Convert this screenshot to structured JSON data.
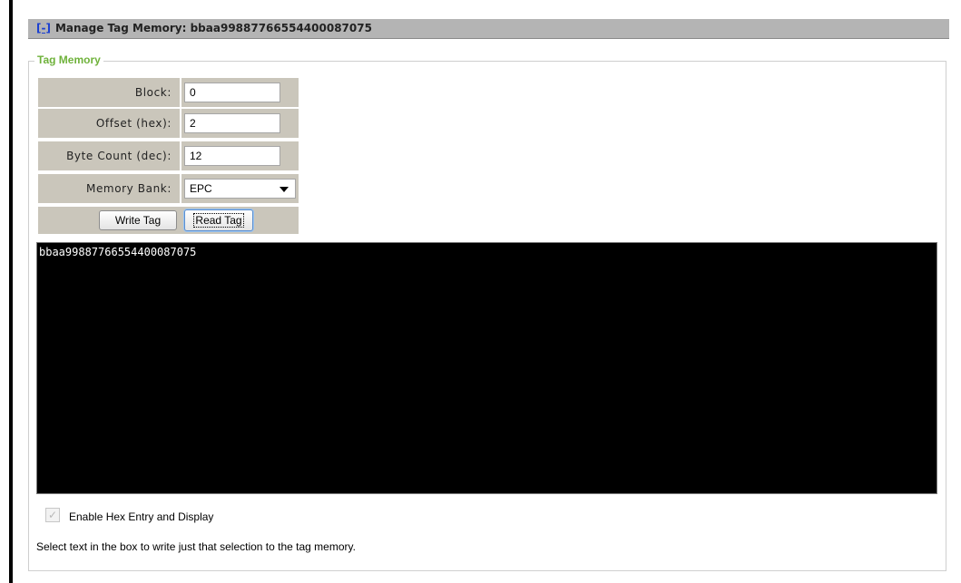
{
  "header": {
    "toggle_label": "[-]",
    "title": "Manage Tag Memory: bbaa99887766554400087075"
  },
  "section": {
    "legend": "Tag Memory"
  },
  "form": {
    "block_label": "Block:",
    "block_value": "0",
    "offset_label": "Offset (hex):",
    "offset_value": "2",
    "byte_count_label": "Byte Count (dec):",
    "byte_count_value": "12",
    "memory_bank_label": "Memory Bank:",
    "memory_bank_value": "EPC",
    "write_button": "Write Tag",
    "read_button": "Read Tag"
  },
  "memory_box": {
    "content": "bbaa99887766554400087075"
  },
  "options": {
    "hex_checkbox_label": "Enable Hex Entry and Display",
    "hex_checked": true
  },
  "hint": "Select text in the box to write just that selection to the tag memory.",
  "colors": {
    "header_bg": "#b4b4b4",
    "legend": "#6fb23b",
    "label_cell_bg": "#cac6bb",
    "memory_bg": "#000000",
    "link": "#1a3fd1"
  },
  "icons": {
    "dropdown": "chevron-down-icon",
    "checkbox": "checkmark-icon"
  }
}
